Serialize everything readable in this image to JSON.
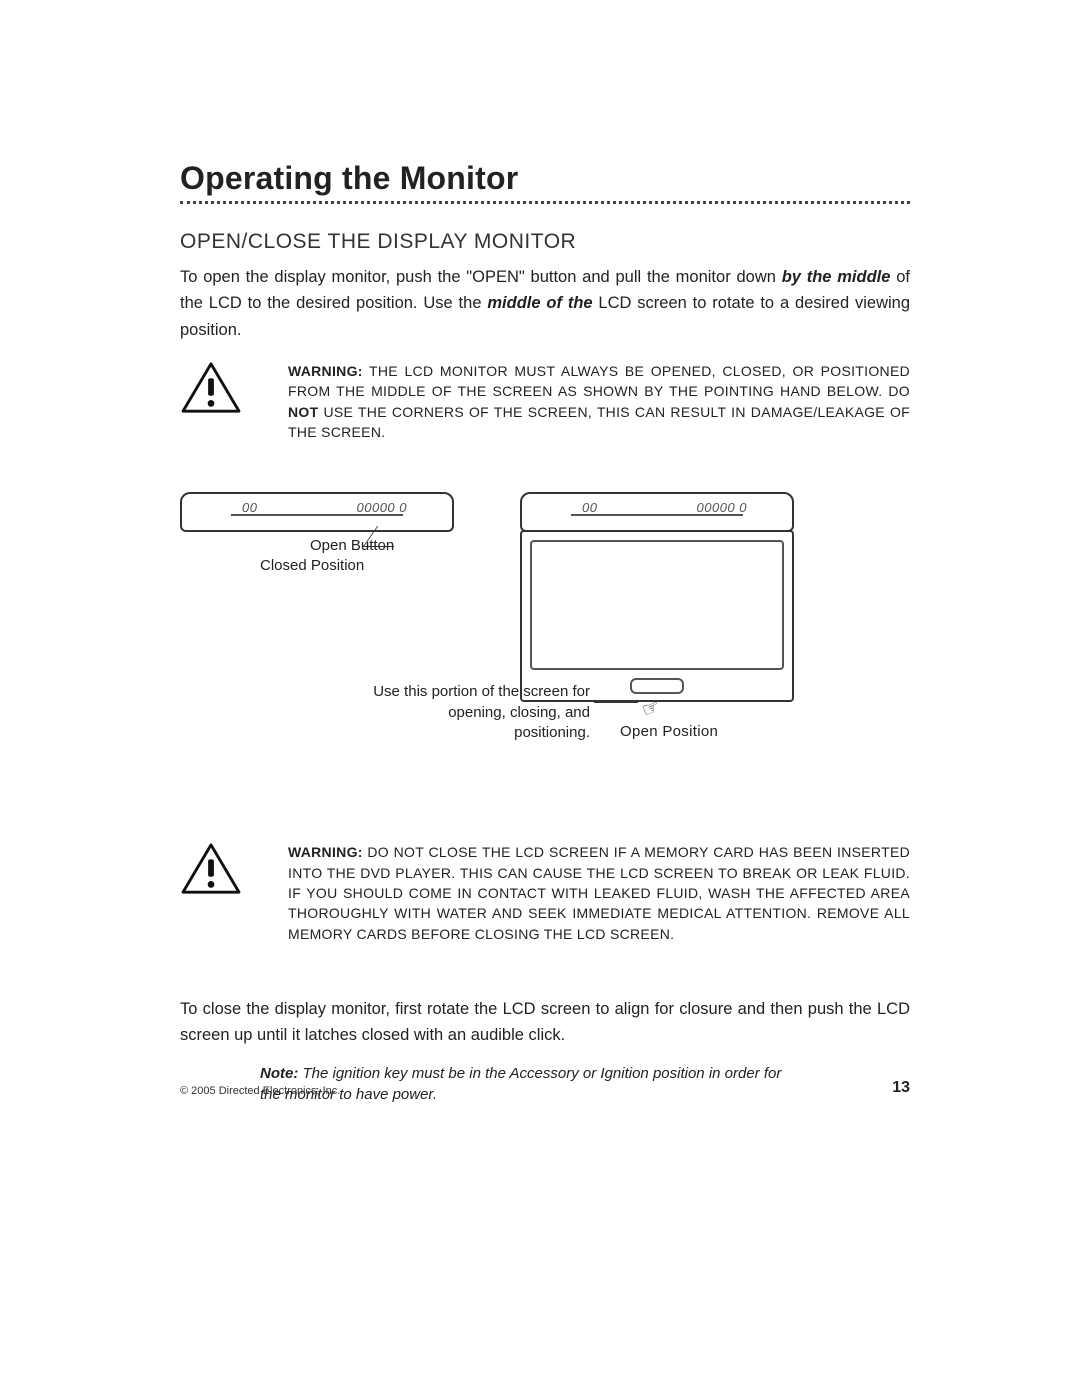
{
  "title": "Operating the Monitor",
  "subhead": "OPEN/CLOSE THE DISPLAY MONITOR",
  "intro": {
    "p1a": "To open the display monitor, push the \"OPEN\" button and pull the monitor down ",
    "p1b_em": "by the middle",
    "p1c": " of the LCD to the desired position. Use the ",
    "p1d_em": "middle of the",
    "p1e": " LCD screen to rotate to a desired viewing position."
  },
  "warning1": {
    "label": "WARNING:",
    "t1": " THE LCD MONITOR MUST ALWAYS BE OPENED, CLOSED, OR POSITIONED FROM THE MIDDLE OF THE SCREEN AS SHOWN BY THE POINTING HAND BELOW. DO ",
    "not": "NOT",
    "t2": " USE THE CORNERS OF THE SCREEN, THIS CAN RESULT IN DAMAGE/LEAKAGE OF THE SCREEN."
  },
  "diagram": {
    "open_button": "Open Button",
    "closed_position": "Closed Position",
    "use_portion": "Use this portion of the screen for opening, closing, and positioning.",
    "open_position": "Open Position"
  },
  "warning2": {
    "label": "WARNING:",
    "text": " DO NOT CLOSE THE LCD SCREEN IF A MEMORY CARD HAS BEEN INSERTED INTO THE DVD PLAYER. THIS CAN CAUSE THE LCD SCREEN TO BREAK OR LEAK FLUID. IF YOU SHOULD COME IN CONTACT WITH LEAKED FLUID, WASH THE AFFECTED AREA THOROUGHLY WITH WATER AND SEEK IMMEDIATE MEDICAL ATTENTION. REMOVE ALL MEMORY CARDS BEFORE CLOSING THE LCD SCREEN."
  },
  "close_para": "To close the display monitor, first rotate the LCD screen to align for closure and then push the LCD screen up until it latches closed with an audible click.",
  "note": {
    "label": "Note:",
    "text": " The ignition key must be in the Accessory or Ignition position in order for the monitor to have power."
  },
  "footer": {
    "copyright": "© 2005 Directed Electronics, Inc.",
    "page": "13"
  }
}
